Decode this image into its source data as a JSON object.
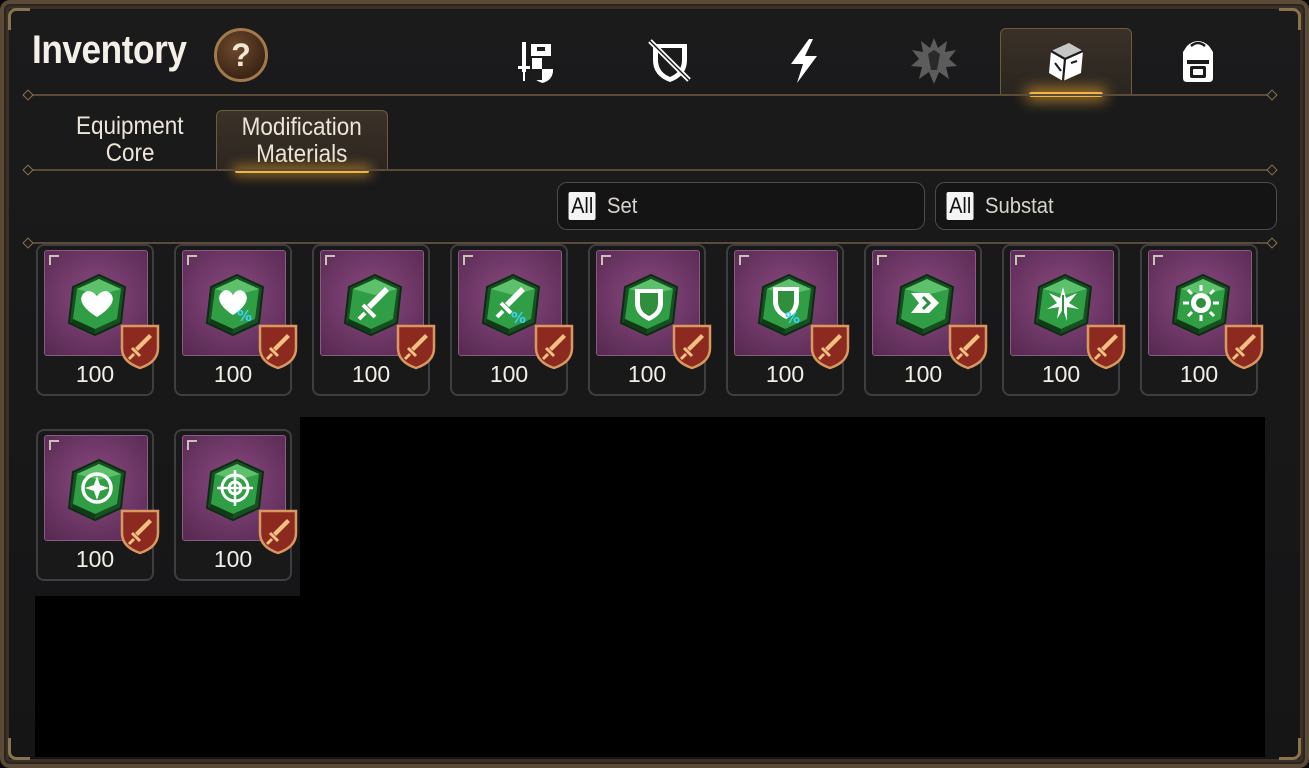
{
  "header": {
    "title": "Inventory",
    "help_label": "?"
  },
  "top_tabs": [
    {
      "icon": "knight-shield-icon",
      "active": false
    },
    {
      "icon": "crossed-sword-shield-icon",
      "active": false
    },
    {
      "icon": "lightning-icon",
      "active": false
    },
    {
      "icon": "spiky-emblem-icon",
      "active": false
    },
    {
      "icon": "crystal-cube-icon",
      "active": true
    },
    {
      "icon": "backpack-icon",
      "active": false
    }
  ],
  "sub_tabs": [
    {
      "line1": "Equipment",
      "line2": "Core",
      "active": false
    },
    {
      "line1": "Modification",
      "line2": "Materials",
      "active": true
    }
  ],
  "filters": {
    "set": {
      "tag": "All",
      "label": "Set"
    },
    "substat": {
      "tag": "All",
      "label": "Substat"
    }
  },
  "items": [
    {
      "icon": "heart-icon",
      "count": "100"
    },
    {
      "icon": "heart-percent-icon",
      "count": "100"
    },
    {
      "icon": "sword-icon",
      "count": "100"
    },
    {
      "icon": "sword-percent-icon",
      "count": "100"
    },
    {
      "icon": "shield-icon",
      "count": "100"
    },
    {
      "icon": "shield-percent-icon",
      "count": "100"
    },
    {
      "icon": "chevron-speed-icon",
      "count": "100"
    },
    {
      "icon": "burst-icon",
      "count": "100"
    },
    {
      "icon": "sun-icon",
      "count": "100"
    },
    {
      "icon": "star-circle-icon",
      "count": "100"
    },
    {
      "icon": "crosshair-icon",
      "count": "100"
    }
  ],
  "colors": {
    "accent_glow": "#f2b640",
    "gem_green": "#2f9e44",
    "item_bg": "#6d3766",
    "badge_red": "#8c2a20"
  }
}
